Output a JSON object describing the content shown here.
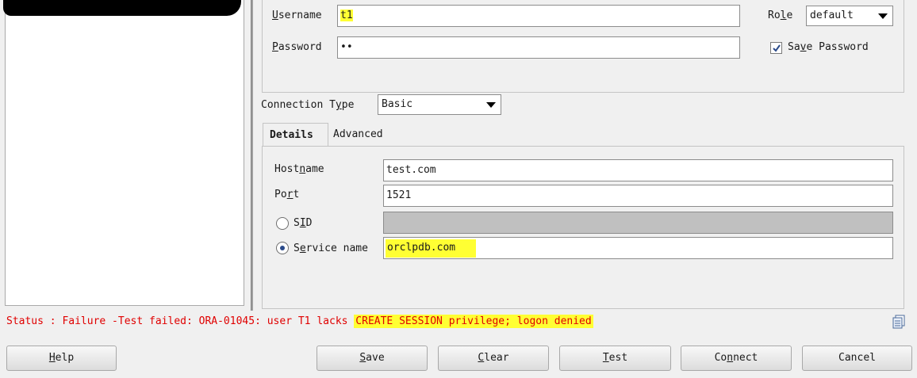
{
  "connection_list": {
    "redacted": true
  },
  "login": {
    "username_label_pre": "",
    "username_label_mn": "U",
    "username_label_post": "sername",
    "username_value": "t1",
    "password_label_mn": "P",
    "password_label_post": "assword",
    "password_value": "••",
    "role_label_pre": "Ro",
    "role_label_mn": "l",
    "role_label_post": "e",
    "role_value": "default",
    "save_password_pre": "Sa",
    "save_password_mn": "v",
    "save_password_post": "e Password",
    "save_password_checked": true
  },
  "connection_type": {
    "label_pre": "Connection T",
    "label_mn": "y",
    "label_post": "pe",
    "value": "Basic"
  },
  "tabs": [
    {
      "label": "Details",
      "active": true
    },
    {
      "label": "Advanced",
      "active": false
    }
  ],
  "details": {
    "hostname_pre": "Host",
    "hostname_mn": "n",
    "hostname_post": "ame",
    "hostname_value": "test.com",
    "port_pre": "Po",
    "port_mn": "r",
    "port_post": "t",
    "port_value": "1521",
    "sid_pre": "S",
    "sid_mn": "I",
    "sid_post": "D",
    "sid_value": "",
    "service_pre": "S",
    "service_mn": "e",
    "service_post": "rvice name",
    "service_value": "orclpdb.com",
    "selected_option": "service_name"
  },
  "status": {
    "prefix": "Status : Failure -Test failed: ORA-01045: user T1 lacks ",
    "highlighted": "CREATE SESSION privilege; logon denied"
  },
  "buttons": {
    "help_mn": "H",
    "help_rest": "elp",
    "save_mn": "S",
    "save_rest": "ave",
    "clear_mn": "C",
    "clear_rest": "lear",
    "test_mn": "T",
    "test_rest": "est",
    "connect_pre": "Co",
    "connect_mn": "n",
    "connect_post": "nect",
    "cancel": "Cancel"
  },
  "colors": {
    "highlight": "#ffff33",
    "status_error": "#e00000"
  },
  "icons": [
    "dropdown-arrow-icon",
    "checkmark-icon",
    "radio-icon",
    "copy-icon"
  ]
}
